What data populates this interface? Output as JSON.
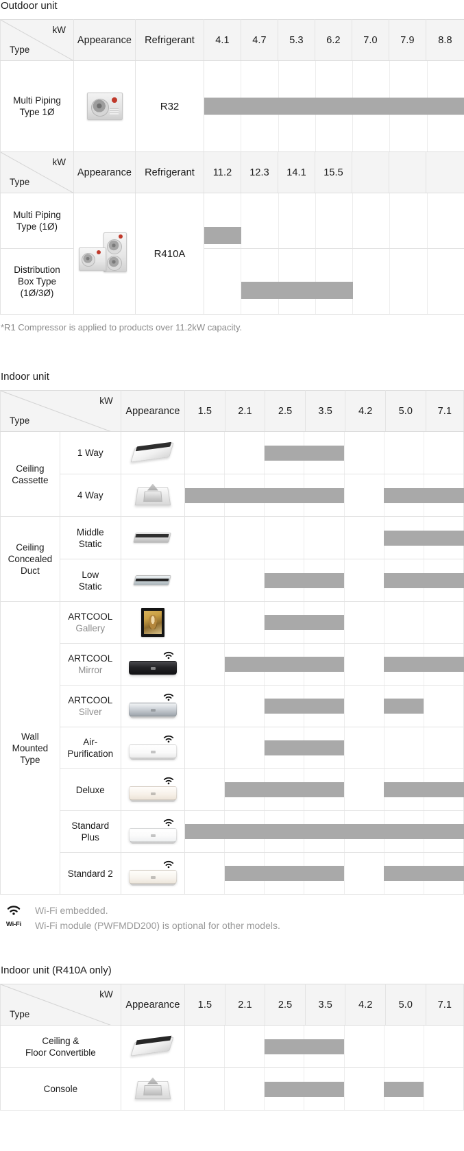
{
  "sections": {
    "outdoor_title": "Outdoor unit",
    "indoor_title": "Indoor unit",
    "indoor_r410a_title": "Indoor unit (R410A only)"
  },
  "labels": {
    "type": "Type",
    "kw": "kW",
    "appearance": "Appearance",
    "refrigerant": "Refrigerant"
  },
  "outdoor_r32": {
    "capacities": [
      "4.1",
      "4.7",
      "5.3",
      "6.2",
      "7.0",
      "7.9",
      "8.8"
    ],
    "rows": [
      {
        "type": "Multi Piping\nType 1Ø",
        "type_line1": "Multi Piping",
        "type_line2": "Type 1Ø",
        "refrigerant": "R32",
        "appearance_icon": "outdoor-condenser-single",
        "bar_start": 0,
        "bar_end": 7
      }
    ]
  },
  "outdoor_r410a": {
    "capacities": [
      "11.2",
      "12.3",
      "14.1",
      "15.5"
    ],
    "refrigerant": "R410A",
    "appearance_icon": "outdoor-condenser-pair",
    "rows": [
      {
        "type_line1": "Multi Piping",
        "type_line2": "Type (1Ø)",
        "bar_start": 0,
        "bar_end": 1
      },
      {
        "type_line1": "Distribution",
        "type_line2": "Box Type",
        "type_line3": "(1Ø/3Ø)",
        "bar_start": 1,
        "bar_end": 4
      }
    ]
  },
  "outdoor_footnote": "*R1 Compressor is applied to products over 11.2kW capacity.",
  "indoor": {
    "capacities": [
      "1.5",
      "2.1",
      "2.5",
      "3.5",
      "4.2",
      "5.0",
      "7.1"
    ],
    "groups": [
      {
        "group_line1": "Ceiling",
        "group_line2": "Cassette",
        "rows": [
          {
            "name": "1 Way",
            "sub": "",
            "icon": "cassette-1way",
            "wifi": false,
            "bars": [
              [
                2,
                4
              ]
            ]
          },
          {
            "name": "4 Way",
            "sub": "",
            "icon": "cassette-4way",
            "wifi": false,
            "bars": [
              [
                0,
                4
              ],
              [
                5,
                7
              ]
            ]
          }
        ]
      },
      {
        "group_line1": "Ceiling",
        "group_line2": "Concealed",
        "group_line3": "Duct",
        "rows": [
          {
            "name": "Middle",
            "name2": "Static",
            "sub": "",
            "icon": "duct-middle-static",
            "wifi": false,
            "bars": [
              [
                5,
                7
              ]
            ]
          },
          {
            "name": "Low",
            "name2": "Static",
            "sub": "",
            "icon": "duct-low-static",
            "wifi": false,
            "bars": [
              [
                2,
                4
              ],
              [
                5,
                7
              ]
            ]
          }
        ]
      },
      {
        "group_line1": "Wall",
        "group_line2": "Mounted",
        "group_line3": "Type",
        "rows": [
          {
            "name": "ARTCOOL",
            "sub": "Gallery",
            "icon": "artcool-gallery",
            "wifi": false,
            "bars": [
              [
                2,
                4
              ]
            ]
          },
          {
            "name": "ARTCOOL",
            "sub": "Mirror",
            "icon": "artcool-mirror",
            "wifi": true,
            "bars": [
              [
                1,
                4
              ],
              [
                5,
                7
              ]
            ]
          },
          {
            "name": "ARTCOOL",
            "sub": "Silver",
            "icon": "artcool-silver",
            "wifi": true,
            "bars": [
              [
                2,
                4
              ],
              [
                5,
                6
              ]
            ]
          },
          {
            "name": "Air-",
            "name2": "Purification",
            "sub": "",
            "icon": "air-purification",
            "wifi": true,
            "bars": [
              [
                2,
                4
              ]
            ]
          },
          {
            "name": "Deluxe",
            "sub": "",
            "icon": "deluxe",
            "wifi": true,
            "bars": [
              [
                1,
                4
              ],
              [
                5,
                7
              ]
            ]
          },
          {
            "name": "Standard",
            "name2": "Plus",
            "sub": "",
            "icon": "standard-plus",
            "wifi": true,
            "bars": [
              [
                0,
                7
              ]
            ]
          },
          {
            "name": "Standard 2",
            "sub": "",
            "icon": "standard-2",
            "wifi": true,
            "bars": [
              [
                1,
                4
              ],
              [
                5,
                7
              ]
            ]
          }
        ]
      }
    ]
  },
  "wifi_legend": {
    "badge_label": "Wi-Fi",
    "line1": "Wi-Fi embedded.",
    "line2": "Wi-Fi module (PWFMDD200) is optional for other models."
  },
  "indoor_r410a": {
    "capacities": [
      "1.5",
      "2.1",
      "2.5",
      "3.5",
      "4.2",
      "5.0",
      "7.1"
    ],
    "rows": [
      {
        "name": "Ceiling &",
        "name2": "Floor Convertible",
        "icon": "ceiling-floor-convertible",
        "bars": [
          [
            2,
            4
          ]
        ]
      },
      {
        "name": "Console",
        "name2": "",
        "icon": "console",
        "bars": [
          [
            2,
            4
          ],
          [
            5,
            6
          ]
        ]
      }
    ]
  },
  "colors": {
    "bar": "#a9a9a9",
    "header_bg": "#f4f4f4",
    "border": "#e3e3e3",
    "muted_text": "#8e8e8e"
  }
}
